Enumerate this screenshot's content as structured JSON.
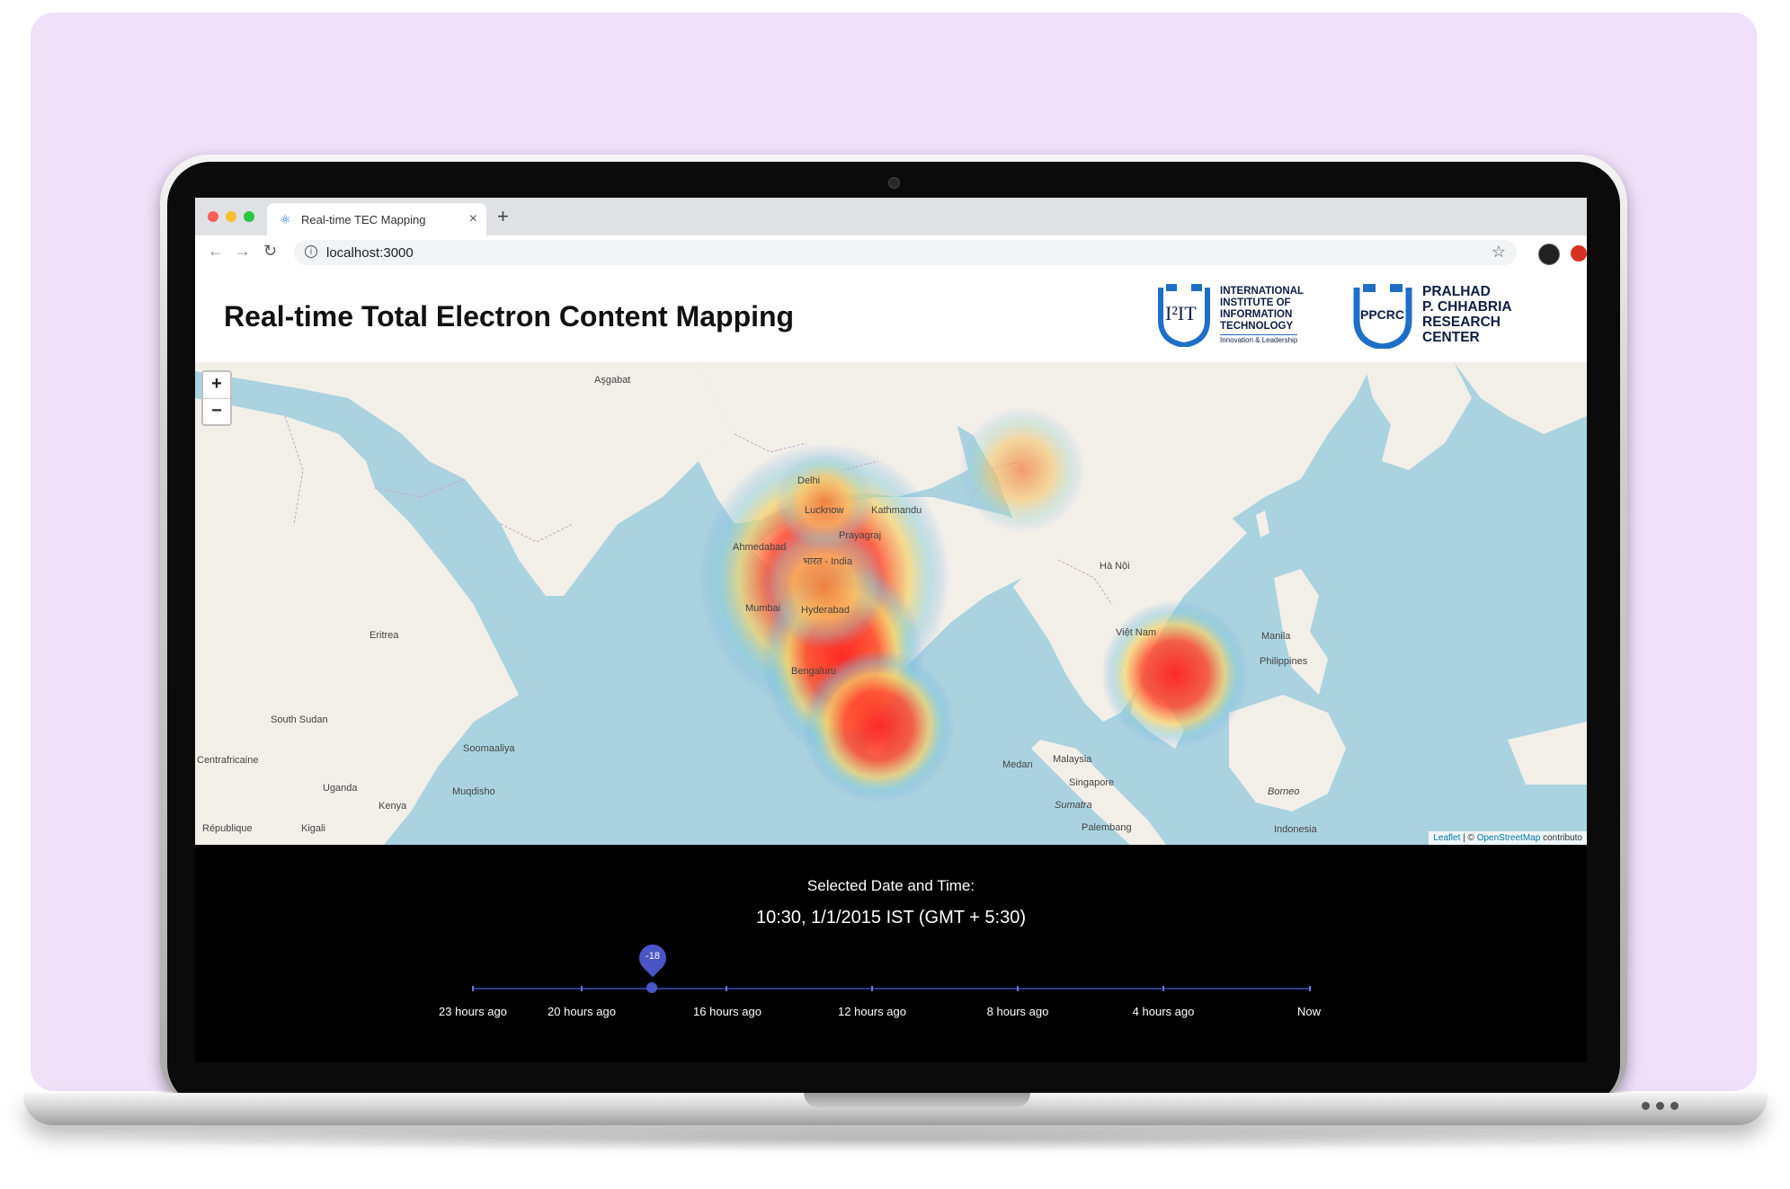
{
  "browser": {
    "tab_title": "Real-time TEC Mapping",
    "tab_close": "×",
    "new_tab": "+",
    "url": "localhost:3000"
  },
  "header": {
    "title": "Real-time Total Electron Content Mapping",
    "logo1": {
      "mark": "I²IT",
      "lines": [
        "INTERNATIONAL",
        "INSTITUTE OF",
        "INFORMATION",
        "TECHNOLOGY"
      ],
      "tagline": "Innovation & Leadership"
    },
    "logo2": {
      "mark": "PPCRC",
      "lines": [
        "PRALHAD",
        "P. CHHABRIA",
        "RESEARCH",
        "CENTER"
      ]
    }
  },
  "map": {
    "zoom_in": "+",
    "zoom_out": "−",
    "attribution_leaflet": "Leaflet",
    "attribution_sep": " | © ",
    "attribution_osm": "OpenStreetMap",
    "attribution_tail": " contributo",
    "labels": {
      "delhi": "Delhi",
      "lucknow": "Lucknow",
      "kathmandu": "Kathmandu",
      "prayagraj": "Prayagraj",
      "ahmedabad": "Ahmedabad",
      "mumbai": "Mumbai",
      "hyderabad": "Hyderabad",
      "bengaluru": "Bengaluru",
      "india": "भारत - India",
      "ha_noi": "Hà Nội",
      "manila": "Manila",
      "philippines": "Philippines",
      "malaysia": "Malaysia",
      "singapore": "Singapore",
      "medan": "Medan",
      "sumatra": "Sumatra",
      "palembang": "Palembang",
      "borneo": "Borneo",
      "indonesia": "Indonesia",
      "viet_nam": "Việt Nam",
      "south_sudan": "South Sudan",
      "uganda": "Uganda",
      "kenya": "Kenya",
      "kigali": "Kigali",
      "muqdisho": "Muqdisho",
      "soomaaliya": "Soomaaliya",
      "eritrea": "Eritrea",
      "asgabat": "Aşgabat",
      "republique": "République",
      "centrafricaine": "Centrafricaine"
    }
  },
  "timeline": {
    "selected_label": "Selected Date and Time:",
    "selected_value": "10:30, 1/1/2015 IST (GMT + 5:30)",
    "handle_value": "-18",
    "handle_hours_ago": 18,
    "tick_labels": [
      "23 hours ago",
      "20 hours ago",
      "16 hours ago",
      "12 hours ago",
      "8 hours ago",
      "4 hours ago",
      "Now"
    ]
  },
  "colors": {
    "accent": "#4a56c6",
    "ocean": "#aad3df",
    "land": "#f2efe9",
    "bg_card": "#f0e0fa"
  }
}
